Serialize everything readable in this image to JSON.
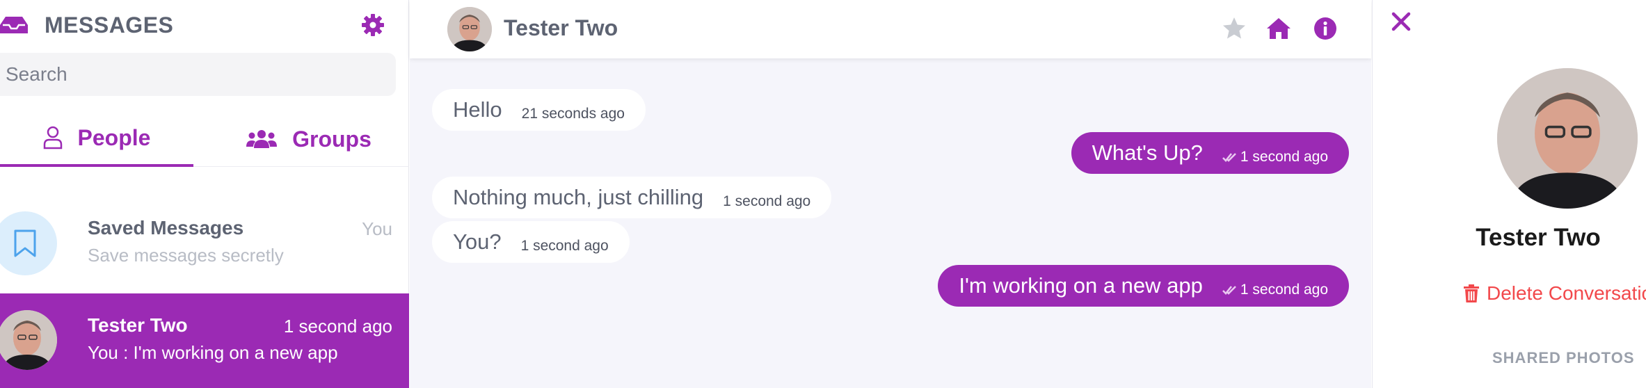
{
  "sidebar": {
    "title": "MESSAGES",
    "search_placeholder": "Search",
    "tabs": [
      {
        "label": "People",
        "icon": "user-icon",
        "active": true
      },
      {
        "label": "Groups",
        "icon": "users-icon",
        "active": false
      }
    ],
    "conversations": [
      {
        "name": "Saved Messages",
        "subtitle": "Save messages secretly",
        "time": "You",
        "icon": "bookmark-icon"
      },
      {
        "name": "Tester Two",
        "subtitle": "You : I'm working on a new app",
        "time": "1 second ago",
        "active": true
      }
    ]
  },
  "chat": {
    "contact_name": "Tester Two",
    "header_icons": [
      "star-icon",
      "home-icon",
      "info-icon"
    ],
    "messages": [
      {
        "direction": "in",
        "text": "Hello",
        "time": "21 seconds ago"
      },
      {
        "direction": "out",
        "text": "What's Up?",
        "time": "1 second ago",
        "status": "seen"
      },
      {
        "direction": "in",
        "text": "Nothing much, just chilling",
        "time": "1 second ago"
      },
      {
        "direction": "in",
        "text": "You?",
        "time": "1 second ago"
      },
      {
        "direction": "out",
        "text": "I'm working on a new app",
        "time": "1 second ago",
        "status": "seen"
      }
    ]
  },
  "info_panel": {
    "name": "Tester Two",
    "delete_label": "Delete Conversation",
    "shared_photos_label": "SHARED PHOTOS"
  },
  "colors": {
    "accent": "#9b2ab4",
    "danger": "#f2484b",
    "text_muted": "#5d6372",
    "chat_bg": "#f5f5fb"
  }
}
